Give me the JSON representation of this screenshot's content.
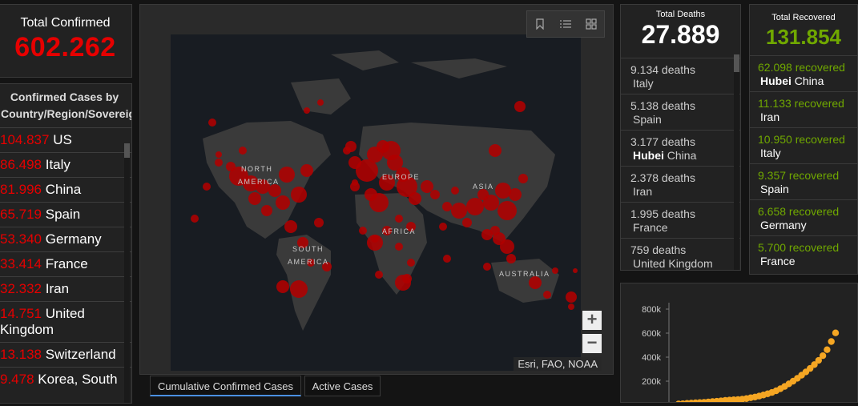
{
  "total_confirmed": {
    "label": "Total Confirmed",
    "value": "602.262"
  },
  "country_list": {
    "header": "Confirmed Cases by Country/Region/Sovereignty",
    "items": [
      {
        "count": "104.837",
        "name": "US"
      },
      {
        "count": "86.498",
        "name": "Italy"
      },
      {
        "count": "81.996",
        "name": "China"
      },
      {
        "count": "65.719",
        "name": "Spain"
      },
      {
        "count": "53.340",
        "name": "Germany"
      },
      {
        "count": "33.414",
        "name": "France"
      },
      {
        "count": "32.332",
        "name": "Iran"
      },
      {
        "count": "14.751",
        "name": "United Kingdom"
      },
      {
        "count": "13.138",
        "name": "Switzerland"
      },
      {
        "count": "9.478",
        "name": "Korea, South"
      }
    ]
  },
  "map": {
    "labels": [
      "NORTH",
      "AMERICA",
      "EUROPE",
      "ASIA",
      "AFRICA",
      "SOUTH",
      "AMERICA",
      "AUSTRALIA"
    ],
    "attribution": "Esri, FAO, NOAA",
    "zoom_in": "+",
    "zoom_out": "−",
    "tool_icons": [
      "bookmark-icon",
      "list-icon",
      "qr-grid-icon"
    ],
    "dot_color": "#b00000"
  },
  "tabs": [
    {
      "label": "Cumulative Confirmed Cases",
      "active": true
    },
    {
      "label": "Active Cases",
      "active": false
    }
  ],
  "deaths": {
    "label": "Total Deaths",
    "value": "27.889",
    "items": [
      {
        "count": "9.134 deaths",
        "place": "Italy",
        "region": ""
      },
      {
        "count": "5.138 deaths",
        "place": "Spain",
        "region": ""
      },
      {
        "count": "3.177 deaths",
        "place": "China",
        "region": "Hubei"
      },
      {
        "count": "2.378 deaths",
        "place": "Iran",
        "region": ""
      },
      {
        "count": "1.995 deaths",
        "place": "France",
        "region": ""
      },
      {
        "count": "759 deaths",
        "place": "United Kingdom",
        "region": ""
      }
    ]
  },
  "recovered": {
    "label": "Total Recovered",
    "value": "131.854",
    "items": [
      {
        "count": "62.098 recovered",
        "place": "China",
        "region": "Hubei"
      },
      {
        "count": "11.133 recovered",
        "place": "Iran",
        "region": ""
      },
      {
        "count": "10.950 recovered",
        "place": "Italy",
        "region": ""
      },
      {
        "count": "9.357 recovered",
        "place": "Spain",
        "region": ""
      },
      {
        "count": "6.658 recovered",
        "place": "Germany",
        "region": ""
      },
      {
        "count": "5.700 recovered",
        "place": "France",
        "region": ""
      }
    ]
  },
  "colors": {
    "confirmed": "#e60000",
    "recovered": "#70a800",
    "chart": "#f5a623",
    "background": "#141414"
  },
  "chart_data": {
    "type": "scatter",
    "yticks": [
      "800k",
      "600k",
      "400k",
      "200k"
    ],
    "ylim": [
      0,
      800000
    ],
    "values": [
      10000,
      12000,
      15000,
      18000,
      20000,
      22000,
      24000,
      27000,
      30000,
      33000,
      36000,
      40000,
      43000,
      45000,
      47000,
      50000,
      55000,
      62000,
      68000,
      76000,
      85000,
      95000,
      106000,
      120000,
      137000,
      156000,
      178000,
      200000,
      224000,
      250000,
      277000,
      306000,
      338000,
      373000,
      412000,
      462000,
      530000,
      602000
    ]
  }
}
